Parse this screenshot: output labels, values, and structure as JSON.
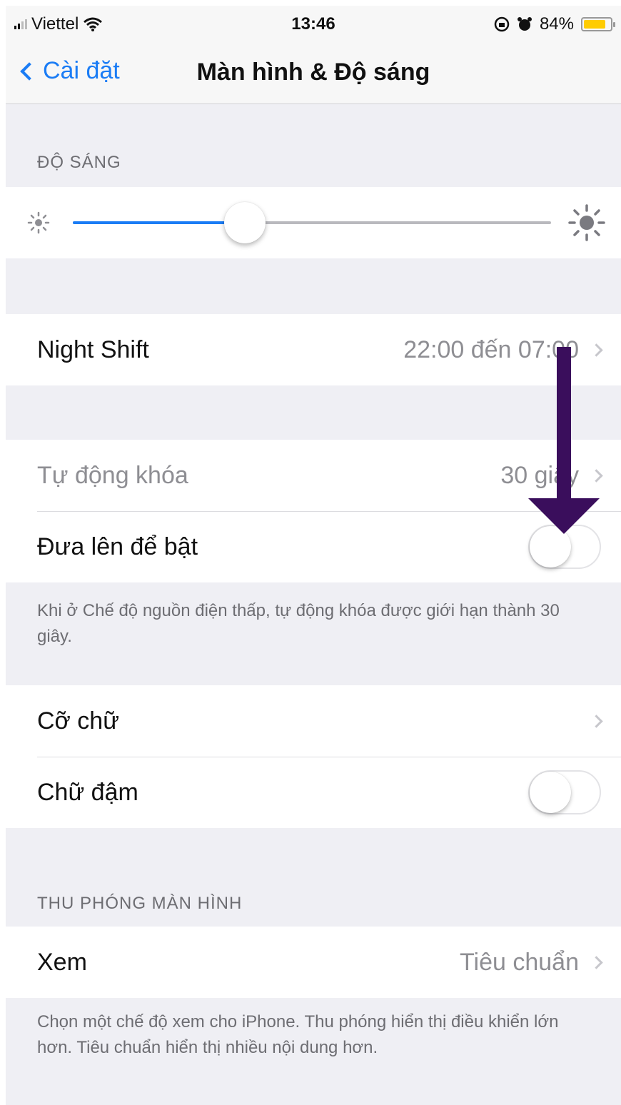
{
  "status_bar": {
    "carrier": "Viettel",
    "time": "13:46",
    "battery": "84%",
    "battery_level": 0.84,
    "battery_color": "#ffcc00"
  },
  "nav": {
    "back_label": "Cài đặt",
    "title": "Màn hình & Độ sáng"
  },
  "brightness": {
    "header": "ĐỘ SÁNG",
    "level": 0.36
  },
  "night_shift": {
    "label": "Night Shift",
    "value": "22:00 đến 07:00"
  },
  "lock": {
    "auto_lock_label": "Tự động khóa",
    "auto_lock_value": "30 giây",
    "raise_to_wake_label": "Đưa lên để bật",
    "raise_to_wake_on": false,
    "footer": "Khi ở Chế độ nguồn điện thấp, tự động khóa được giới hạn thành 30 giây."
  },
  "text": {
    "text_size_label": "Cỡ chữ",
    "bold_text_label": "Chữ đậm",
    "bold_text_on": false
  },
  "zoom": {
    "header": "THU PHÓNG MÀN HÌNH",
    "view_label": "Xem",
    "view_value": "Tiêu chuẩn",
    "footer": "Chọn một chế độ xem cho iPhone. Thu phóng hiển thị điều khiển lớn hơn. Tiêu chuẩn hiển thị nhiều nội dung hơn."
  },
  "colors": {
    "accent": "#1a7cf5",
    "annotation_arrow": "#3a0e5c"
  }
}
